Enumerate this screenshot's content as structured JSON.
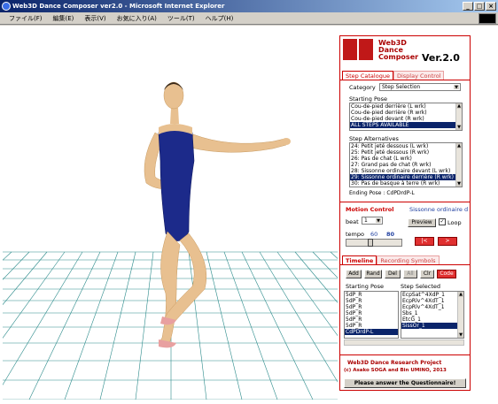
{
  "window": {
    "title": "Web3D Dance Composer ver2.0 - Microsoft Internet Explorer",
    "controls": [
      "_",
      "□",
      "×"
    ]
  },
  "menubar": {
    "items": [
      "ファイル(F)",
      "編集(E)",
      "表示(V)",
      "お気に入り(A)",
      "ツール(T)",
      "ヘルプ(H)"
    ]
  },
  "panel": {
    "banner": {
      "title_line1": "Web3D",
      "title_line2": "Dance",
      "title_line3": "Composer",
      "version": "Ver.2.0"
    },
    "tabs_top": [
      "Step Catalogue",
      "Display Control"
    ],
    "category_label": "Category",
    "category_value": "Step Selection",
    "starting_pose_label": "Starting Pose",
    "starting_pose_items": [
      "Cou-de-pied derrière (L wrk)",
      "Cou-de-pied derrière (R wrk)",
      "Cou-de-pied devant (R wrk)",
      "ALL STEPS AVAILABLE"
    ],
    "step_alternatives_label": "Step Alternatives",
    "step_alternatives_items": [
      "24: Petit jeté dessous (L wrk)",
      "25: Petit jeté dessous (R wrk)",
      "26: Pas de chat (L wrk)",
      "27: Grand pas de chat (R wrk)",
      "28: Sissonne ordinaire devant (L wrk)",
      "29: Sissonne ordinaire derrière (R wrk)",
      "30: Pas de basque à terre (R wrk)"
    ],
    "ending_pose": "Ending Pose : CdPDrdP-L",
    "motion_control_label": "Motion Control",
    "motion_control_value": "Sissonne ordinaire d",
    "beat_label": "beat",
    "beat_value": "1",
    "preview_label": "Preview",
    "loop_label": "Loop",
    "tempo_label": "tempo",
    "tempo_min": "60",
    "tempo_value": "80",
    "rewind_label": "|<",
    "play_label": ">",
    "tabs_bottom": [
      "Timeline",
      "Recording Symbols"
    ],
    "timeline_buttons": [
      "Add",
      "Rand",
      "Del",
      "All",
      "Clr",
      "Code"
    ],
    "starting_pose_col_label": "Starting Pose",
    "step_selected_col_label": "Step Selected",
    "timeline_starting": [
      "5dP_R",
      "5dP_R",
      "5dP_R",
      "5dP_R",
      "5dP_R",
      "5dP_R",
      "CdPDrdP-L"
    ],
    "timeline_selected": [
      "EcpSat^4XdP_1",
      "EcpRlv^4XdT_1",
      "EcpRlv^4XdT_1",
      "Sbs_1",
      "EtcG_1",
      "SissOr_1"
    ],
    "footer_line1": "Web3D Dance Research Project",
    "footer_line2": "(c) Asako SOGA and Bin UMINO, 2013",
    "questionnaire_label": "Please answer the Questionnaire!"
  },
  "colors": {
    "accent": "#c00000",
    "selection": "#0a246a",
    "grid": "#2a8a8a",
    "leotard": "#1c2a8a",
    "skin": "#e8c090"
  }
}
